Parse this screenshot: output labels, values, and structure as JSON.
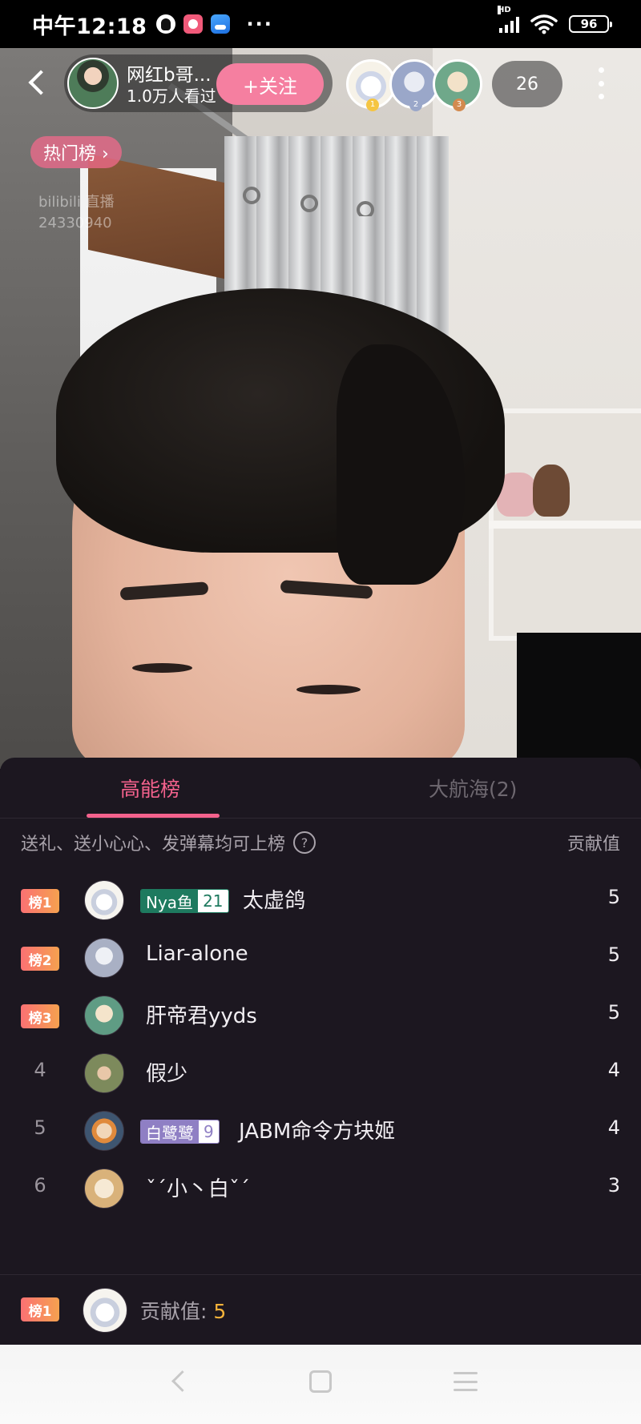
{
  "status_bar": {
    "time": "中午12:18",
    "more": "···",
    "network_badge": "HD",
    "battery": "96",
    "icons": [
      "qq-icon",
      "app-red-icon",
      "app-blue-icon",
      "signal-icon",
      "wifi-icon",
      "battery-icon"
    ]
  },
  "live": {
    "host_name": "网红b哥...",
    "host_views": "1.0万人看过",
    "follow_label": "+关注",
    "online_count": "26",
    "hot_tag": "热门榜 ›",
    "watermark_brand": "bilibili 直播",
    "watermark_room": "24330940",
    "top_viewers": [
      {
        "rank": "1",
        "color": "#f5c542"
      },
      {
        "rank": "2",
        "color": "#9aa7c9"
      },
      {
        "rank": "3",
        "color": "#d38a4f"
      }
    ]
  },
  "sheet": {
    "tab_active": "高能榜",
    "tab_inactive": "大航海(2)",
    "hint": "送礼、送小心心、发弹幕均可上榜",
    "hint_icon": "?",
    "contrib_header": "贡献值",
    "rows": [
      {
        "rank_badge": "榜1",
        "name": "太虚鸽",
        "medal_name": "Nya鱼",
        "medal_level": "21",
        "medal_color": "#1e7a5f",
        "score": "5"
      },
      {
        "rank_badge": "榜2",
        "name": "Liar-alone",
        "score": "5"
      },
      {
        "rank_badge": "榜3",
        "name": "肝帝君yyds",
        "score": "5"
      },
      {
        "rank": "4",
        "name": "假少",
        "score": "4"
      },
      {
        "rank": "5",
        "name": "JABM命令方块姬",
        "medal_name": "白鹭鹭",
        "medal_level": "9",
        "medal_color": "#8f7fc4",
        "score": "4"
      },
      {
        "rank": "6",
        "name": "ˇˊ小丶白ˇˊ",
        "score": "3"
      }
    ],
    "footer": {
      "rank_badge": "榜1",
      "label": "贡献值: ",
      "value": "5"
    }
  },
  "colors": {
    "accent_pink": "#f4628d",
    "follow_pink": "#f57fa0",
    "gold": "#f5b33a"
  }
}
